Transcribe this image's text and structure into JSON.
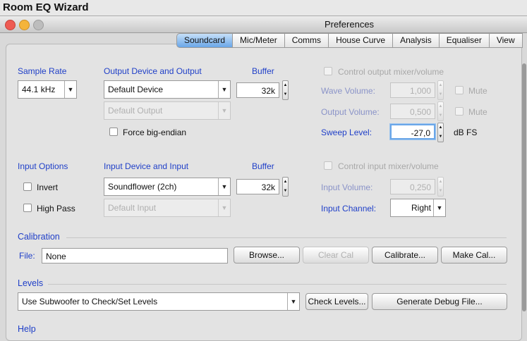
{
  "app": {
    "name": "Room EQ Wizard"
  },
  "window": {
    "title": "Preferences"
  },
  "tabs": [
    {
      "label": "Soundcard",
      "selected": true
    },
    {
      "label": "Mic/Meter",
      "selected": false
    },
    {
      "label": "Comms",
      "selected": false
    },
    {
      "label": "House Curve",
      "selected": false
    },
    {
      "label": "Analysis",
      "selected": false
    },
    {
      "label": "Equaliser",
      "selected": false
    },
    {
      "label": "View",
      "selected": false
    }
  ],
  "output": {
    "sample_rate_label": "Sample Rate",
    "sample_rate_value": "44.1 kHz",
    "device_label": "Output Device and Output",
    "device_value": "Default Device",
    "output_value": "Default Output",
    "buffer_label": "Buffer",
    "buffer_value": "32k",
    "big_endian_label": "Force big-endian",
    "mixer_label": "Control output mixer/volume",
    "wave_volume_label": "Wave Volume:",
    "wave_volume_value": "1,000",
    "output_volume_label": "Output Volume:",
    "output_volume_value": "0,500",
    "mute_label": "Mute",
    "sweep_level_label": "Sweep Level:",
    "sweep_level_value": "-27,0",
    "sweep_unit": "dB FS"
  },
  "input": {
    "options_label": "Input Options",
    "invert_label": "Invert",
    "high_pass_label": "High Pass",
    "device_label": "Input Device and Input",
    "device_value": "Soundflower (2ch)",
    "input_value": "Default Input",
    "buffer_label": "Buffer",
    "buffer_value": "32k",
    "mixer_label": "Control input mixer/volume",
    "volume_label": "Input Volume:",
    "volume_value": "0,250",
    "channel_label": "Input Channel:",
    "channel_value": "Right"
  },
  "calibration": {
    "heading": "Calibration",
    "file_label": "File:",
    "file_value": "None",
    "browse": "Browse...",
    "clear": "Clear Cal",
    "calibrate": "Calibrate...",
    "make": "Make Cal..."
  },
  "levels": {
    "heading": "Levels",
    "mode_value": "Use Subwoofer to Check/Set Levels",
    "check": "Check Levels...",
    "debug": "Generate Debug File..."
  },
  "help": {
    "heading": "Help"
  },
  "colors": {
    "accent": "#1f3fc8",
    "tab_selected": "#6aa6e8"
  }
}
